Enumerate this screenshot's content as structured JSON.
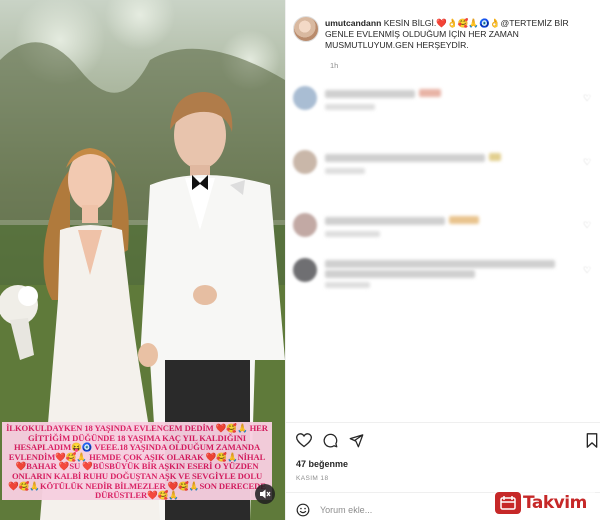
{
  "post": {
    "username": "umutcandann",
    "caption": "KESİN BİLGİ.❤️👌🥰🙏🧿👌@TERTEMİZ BİR GENLE EVLENMİŞ OLDUĞUM İÇİN HER ZAMAN MUSMUTLUYUM.GEN HERŞEYDİR.",
    "time_ago": "1h",
    "likes": "47 beğenme",
    "date": "KASIM 18"
  },
  "media": {
    "overlay_text": "İLKOKULDAYKEN 18 YAŞINDA EVLENCEM DEDİM ❤️🥰🙏 HER GİTTİĞİM DÜĞÜNDE 18 YAŞIMA KAÇ YIL KALDIĞINI HESAPLADIM😝🧿 VEEE.18 YAŞINDA OLDUĞUM ZAMANDA EVLENDİM❤️🥰🙏 HEMDE ÇOK AŞIK OLARAK ❤️🥰🙏NİHAL ❤️BAHAR ❤️SU ❤️BÜSBÜYÜK BİR AŞKIN ESERİ O YÜZDEN ONLARIN KALBİ RUHU DOĞUŞTAN AŞK VE SEVGİYLE DOLU ❤️🥰🙏KÖTÜLÜK NEDİR BİLMEZLER ❤️🥰🙏SON DERECEDE DÜRÜSTLER❤️🥰🙏"
  },
  "comments": [
    {
      "id": 1,
      "blurred": true
    },
    {
      "id": 2,
      "blurred": true
    },
    {
      "id": 3,
      "blurred": true
    },
    {
      "id": 4,
      "blurred": true
    }
  ],
  "compose": {
    "placeholder": "Yorum ekle..."
  },
  "icons": {
    "like": "heart-icon",
    "comment": "comment-icon",
    "share": "send-icon",
    "save": "bookmark-icon",
    "emoji": "smiley-icon",
    "mute": "speaker-muted-icon"
  },
  "watermark": {
    "text": "Takvim"
  },
  "colors": {
    "overlay_bg": "#f7cfe0",
    "overlay_text": "#d81b60",
    "watermark": "#c62828"
  }
}
